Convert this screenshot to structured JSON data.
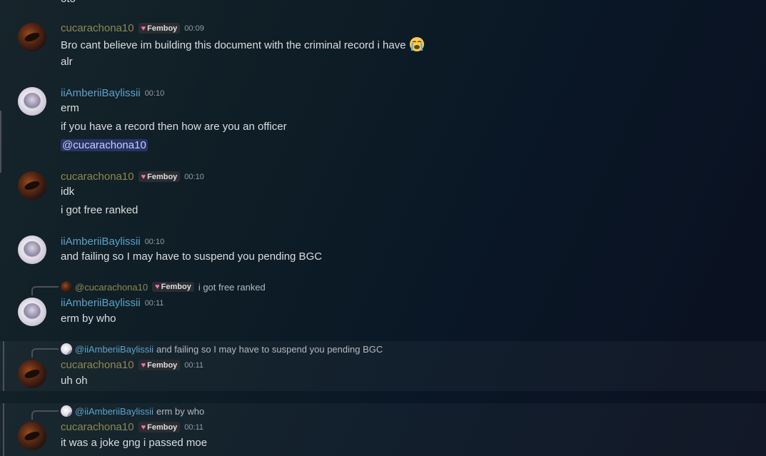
{
  "top_partial": "oto",
  "badge": "Femboy",
  "users": {
    "cuca": "cucarachona10",
    "amber": "iiAmberiiBaylissii"
  },
  "messages": [
    {
      "user": "cucarachona10",
      "time": "00:09",
      "lines": [
        "Bro cant believe im building this document with the criminal record i have",
        "alr"
      ],
      "emoji": "loudly-crying-face"
    },
    {
      "user": "iiAmberiiBaylissii",
      "time": "00:10",
      "lines": [
        "erm",
        "if you have a record then how are you an officer"
      ],
      "mention": "@cucarachona10"
    },
    {
      "user": "cucarachona10",
      "time": "00:10",
      "lines": [
        "idk",
        "i got free ranked"
      ]
    },
    {
      "user": "iiAmberiiBaylissii",
      "time": "00:10",
      "lines": [
        "and failing so I may have to suspend you pending BGC"
      ]
    },
    {
      "user": "iiAmberiiBaylissii",
      "time": "00:11",
      "reply": {
        "to": "@cucarachona10",
        "text": "i got free ranked"
      },
      "lines": [
        "erm by who"
      ]
    },
    {
      "user": "cucarachona10",
      "time": "00:11",
      "reply": {
        "to": "@iiAmberiiBaylissii",
        "text": "and failing so I may have to suspend you pending BGC"
      },
      "lines": [
        "uh oh"
      ]
    },
    {
      "user": "cucarachona10",
      "time": "00:11",
      "reply": {
        "to": "@iiAmberiiBaylissii",
        "text": "erm by who"
      },
      "lines": [
        "it was a joke gng i passed moe"
      ]
    }
  ]
}
